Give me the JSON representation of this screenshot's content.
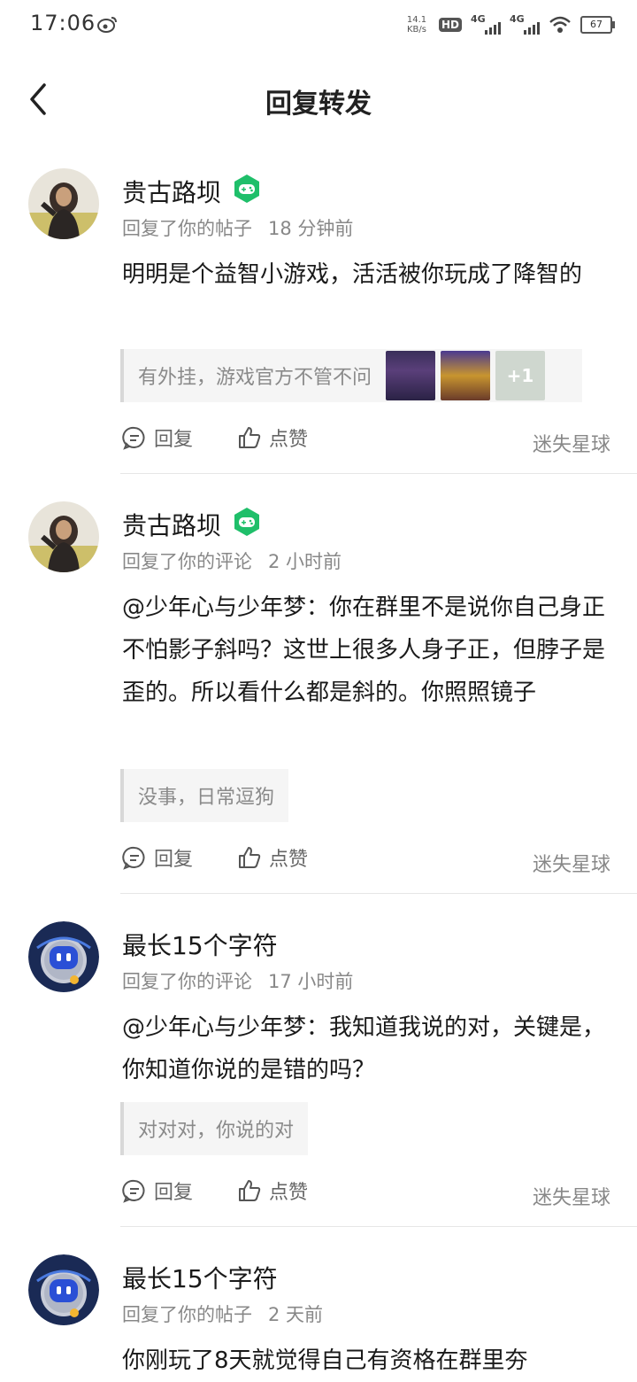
{
  "status_bar": {
    "time": "17:06",
    "net_speed_value": "14.1",
    "net_speed_unit": "KB/s",
    "hd_label": "HD",
    "signal1_label": "4G",
    "signal2_label": "4G",
    "battery": "67"
  },
  "header": {
    "title": "回复转发"
  },
  "labels": {
    "reply": "回复",
    "like": "点赞"
  },
  "items": [
    {
      "user_name": "贵古路坝",
      "meta_action": "回复了你的帖子",
      "meta_time": "18 分钟前",
      "content": "明明是个益智小游戏，活活被你玩成了降智的",
      "quote": "有外挂，游戏官方不管不问",
      "images_extra": "+1",
      "circle": "迷失星球"
    },
    {
      "user_name": "贵古路坝",
      "meta_action": "回复了你的评论",
      "meta_time": "2 小时前",
      "content": "@少年心与少年梦：你在群里不是说你自己身正不怕影子斜吗？这世上很多人身子正，但脖子是歪的。所以看什么都是斜的。你照照镜子",
      "quote": "没事，日常逗狗",
      "circle": "迷失星球"
    },
    {
      "user_name": "最长15个字符",
      "meta_action": "回复了你的评论",
      "meta_time": "17 小时前",
      "content": "@少年心与少年梦：我知道我说的对，关键是，你知道你说的是错的吗？",
      "quote": "对对对，你说的对",
      "circle": "迷失星球"
    },
    {
      "user_name": "最长15个字符",
      "meta_action": "回复了你的帖子",
      "meta_time": "2 天前",
      "content": "你刚玩了8天就觉得自己有资格在群里夯"
    }
  ]
}
